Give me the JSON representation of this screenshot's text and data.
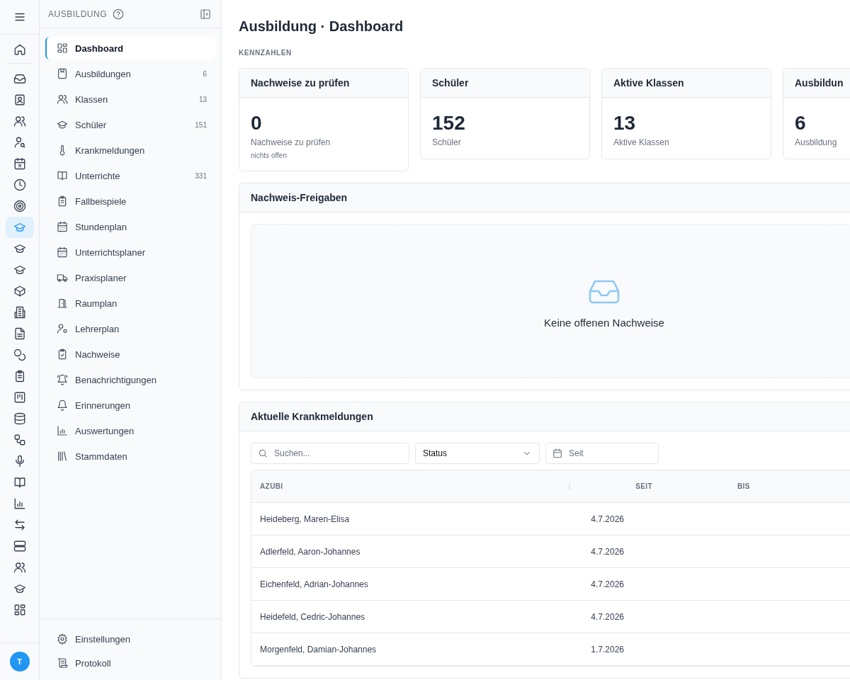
{
  "rail": {
    "items": [
      {
        "kind": "home",
        "selected": false
      },
      {
        "kind": "inbox",
        "selected": false
      },
      {
        "kind": "badge",
        "selected": false
      },
      {
        "kind": "users",
        "selected": false
      },
      {
        "kind": "user-search",
        "selected": false
      },
      {
        "kind": "calendar-x",
        "selected": false
      },
      {
        "kind": "clock",
        "selected": false
      },
      {
        "kind": "target",
        "selected": false
      },
      {
        "kind": "cap",
        "selected": true
      },
      {
        "kind": "cap",
        "selected": false
      },
      {
        "kind": "cap",
        "selected": false
      },
      {
        "kind": "box",
        "selected": false
      },
      {
        "kind": "building",
        "selected": false
      },
      {
        "kind": "file",
        "selected": false
      },
      {
        "kind": "coins",
        "selected": false
      },
      {
        "kind": "clipboard",
        "selected": false
      },
      {
        "kind": "kanban",
        "selected": false
      },
      {
        "kind": "database",
        "selected": false
      },
      {
        "kind": "workflow",
        "selected": false
      },
      {
        "kind": "mic",
        "selected": false
      },
      {
        "kind": "book",
        "selected": false
      },
      {
        "kind": "chart",
        "selected": false
      },
      {
        "kind": "arrows",
        "selected": false
      },
      {
        "kind": "server",
        "selected": false
      },
      {
        "kind": "users",
        "selected": false
      },
      {
        "kind": "cap",
        "selected": false
      },
      {
        "kind": "grid",
        "selected": false
      }
    ],
    "avatar": "T"
  },
  "sidebar": {
    "title": "AUSBILDUNG",
    "items": [
      {
        "label": "Dashboard",
        "kind": "grid",
        "selected": true
      },
      {
        "label": "Ausbildungen",
        "kind": "bookmark",
        "count": "6",
        "selected": false
      },
      {
        "label": "Klassen",
        "kind": "users",
        "count": "13",
        "selected": false
      },
      {
        "label": "Schüler",
        "kind": "cap",
        "count": "151",
        "selected": false
      },
      {
        "label": "Krankmeldungen",
        "kind": "thermometer",
        "selected": false
      },
      {
        "label": "Unterrichte",
        "kind": "book",
        "count": "331",
        "selected": false
      },
      {
        "label": "Fallbeispiele",
        "kind": "clipboard",
        "selected": false
      },
      {
        "label": "Stundenplan",
        "kind": "calendar",
        "selected": false
      },
      {
        "label": "Unterrichtsplaner",
        "kind": "calendar",
        "selected": false
      },
      {
        "label": "Praxisplaner",
        "kind": "truck",
        "selected": false
      },
      {
        "label": "Raumplan",
        "kind": "door",
        "selected": false
      },
      {
        "label": "Lehrerplan",
        "kind": "user-dot",
        "selected": false
      },
      {
        "label": "Nachweise",
        "kind": "clipboard-check",
        "selected": false
      },
      {
        "label": "Benachrichtigungen",
        "kind": "bell-ring",
        "selected": false
      },
      {
        "label": "Erinnerungen",
        "kind": "bell",
        "selected": false
      },
      {
        "label": "Auswertungen",
        "kind": "chart",
        "selected": false
      },
      {
        "label": "Stammdaten",
        "kind": "library",
        "selected": false
      }
    ],
    "footer_items": [
      {
        "label": "Einstellungen",
        "kind": "gear"
      },
      {
        "label": "Protokoll",
        "kind": "scroll"
      }
    ]
  },
  "page": {
    "title": "Ausbildung · Dashboard",
    "section_label": "KENNZAHLEN"
  },
  "kpi_cards": [
    {
      "title": "Nachweise zu prüfen",
      "value": "0",
      "caption": "Nachweise zu prüfen",
      "note": "nichts offen"
    },
    {
      "title": "Schüler",
      "value": "152",
      "caption": "Schüler"
    },
    {
      "title": "Aktive Klassen",
      "value": "13",
      "caption": "Aktive Klassen"
    },
    {
      "title": "Ausbildun",
      "value": "6",
      "caption": "Ausbildung"
    }
  ],
  "approvals": {
    "title": "Nachweis-Freigaben",
    "empty_text": "Keine offenen Nachweise"
  },
  "sick_notes": {
    "title": "Aktuelle Krankmeldungen",
    "search": {
      "placeholder": "Suchen..."
    },
    "status_filter": {
      "value": "Status"
    },
    "since_filter": {
      "placeholder": "Seit"
    },
    "table": {
      "columns": [
        "AZUBI",
        "SEIT",
        "BIS"
      ],
      "rows": [
        {
          "azubi": "Heideberg, Maren-Elisa",
          "seit": "4.7.2026"
        },
        {
          "azubi": "Adlerfeld, Aaron-Johannes",
          "seit": "4.7.2026"
        },
        {
          "azubi": "Eichenfeld, Adrian-Johannes",
          "seit": "4.7.2026"
        },
        {
          "azubi": "Heidefeld, Cedric-Johannes",
          "seit": "4.7.2026"
        },
        {
          "azubi": "Morgenfeld, Damian-Johannes",
          "seit": "1.7.2026"
        }
      ]
    }
  }
}
